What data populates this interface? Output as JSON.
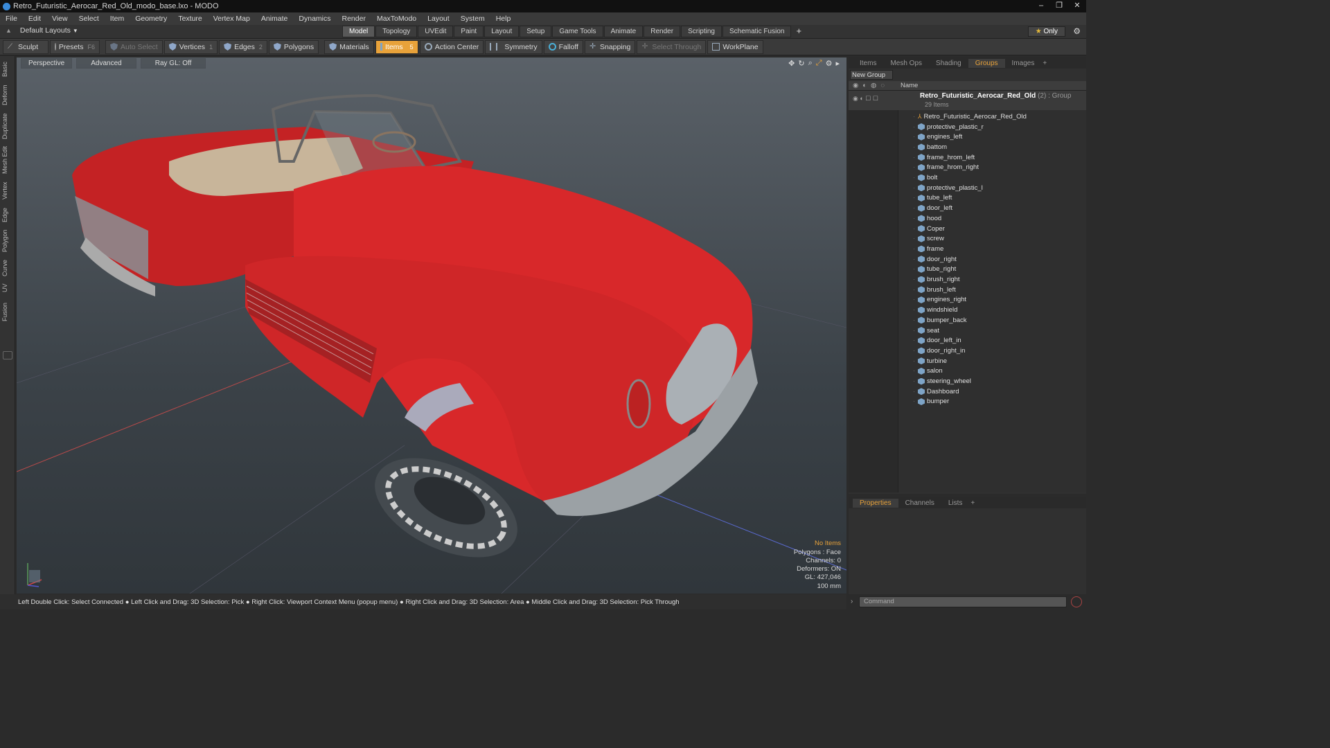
{
  "window": {
    "title": "Retro_Futuristic_Aerocar_Red_Old_modo_base.lxo - MODO",
    "controls": [
      "‒",
      "❐",
      "✕"
    ]
  },
  "menu": [
    "File",
    "Edit",
    "View",
    "Select",
    "Item",
    "Geometry",
    "Texture",
    "Vertex Map",
    "Animate",
    "Dynamics",
    "Render",
    "MaxToModo",
    "Layout",
    "System",
    "Help"
  ],
  "layout_dropdown": "Default Layouts",
  "top_tabs": {
    "items": [
      "Model",
      "Topology",
      "UVEdit",
      "Paint",
      "Layout",
      "Setup",
      "Game Tools",
      "Animate",
      "Render",
      "Scripting",
      "Schematic Fusion"
    ],
    "active": "Model",
    "plus": "+"
  },
  "only_button": "Only",
  "toolbar": {
    "sculpt": "Sculpt",
    "presets": "Presets",
    "presets_key": "F6",
    "auto_select": "Auto Select",
    "vertices": "Vertices",
    "vertices_key": "1",
    "edges": "Edges",
    "edges_key": "2",
    "polygons": "Polygons",
    "materials": "Materials",
    "items": "Items",
    "items_key": "5",
    "action_center": "Action Center",
    "symmetry": "Symmetry",
    "falloff": "Falloff",
    "snapping": "Snapping",
    "select_through": "Select Through",
    "workplane": "WorkPlane"
  },
  "left_tabs": [
    "Basic",
    "Deform",
    "Duplicate",
    "Mesh Edit",
    "Vertex",
    "Edge",
    "Polygon",
    "Curve",
    "UV",
    "Fusion"
  ],
  "viewport": {
    "view": "Perspective",
    "shading": "Advanced",
    "raygl": "Ray GL: Off",
    "info": {
      "no_items": "No Items",
      "polygons": "Polygons : Face",
      "channels": "Channels: 0",
      "deformers": "Deformers: ON",
      "gl": "GL: 427,046",
      "scale": "100 mm"
    }
  },
  "right_panel": {
    "tabs": [
      "Items",
      "Mesh Ops",
      "Shading",
      "Groups",
      "Images"
    ],
    "active_tab": "Groups",
    "new_group": "New Group",
    "column_name": "Name",
    "group": {
      "name": "Retro_Futuristic_Aerocar_Red_Old",
      "count": "(2)",
      "type": ": Group",
      "items_label": "29 Items"
    },
    "items": [
      "Retro_Futuristic_Aerocar_Red_Old",
      "protective_plastic_r",
      "engines_left",
      "battom",
      "frame_hrom_left",
      "frame_hrom_right",
      "bolt",
      "protective_plastic_l",
      "tube_left",
      "door_left",
      "hood",
      "Coper",
      "screw",
      "frame",
      "door_right",
      "tube_right",
      "brush_right",
      "brush_left",
      "engines_right",
      "windshield",
      "bumper_back",
      "seat",
      "door_left_in",
      "door_right_in",
      "turbine",
      "salon",
      "steering_wheel",
      "Dashboard",
      "bumper"
    ]
  },
  "props_panel": {
    "tabs": [
      "Properties",
      "Channels",
      "Lists"
    ],
    "active_tab": "Properties"
  },
  "status_bar": "Left Double Click: Select Connected ● Left Click and Drag: 3D Selection: Pick ● Right Click: Viewport Context Menu (popup menu) ● Right Click and Drag: 3D Selection: Area ● Middle Click and Drag: 3D Selection: Pick Through",
  "command_placeholder": "Command",
  "colors": {
    "accent": "#e8a23a",
    "car_red": "#d8282a",
    "viewport_bg": "#3b4248"
  }
}
